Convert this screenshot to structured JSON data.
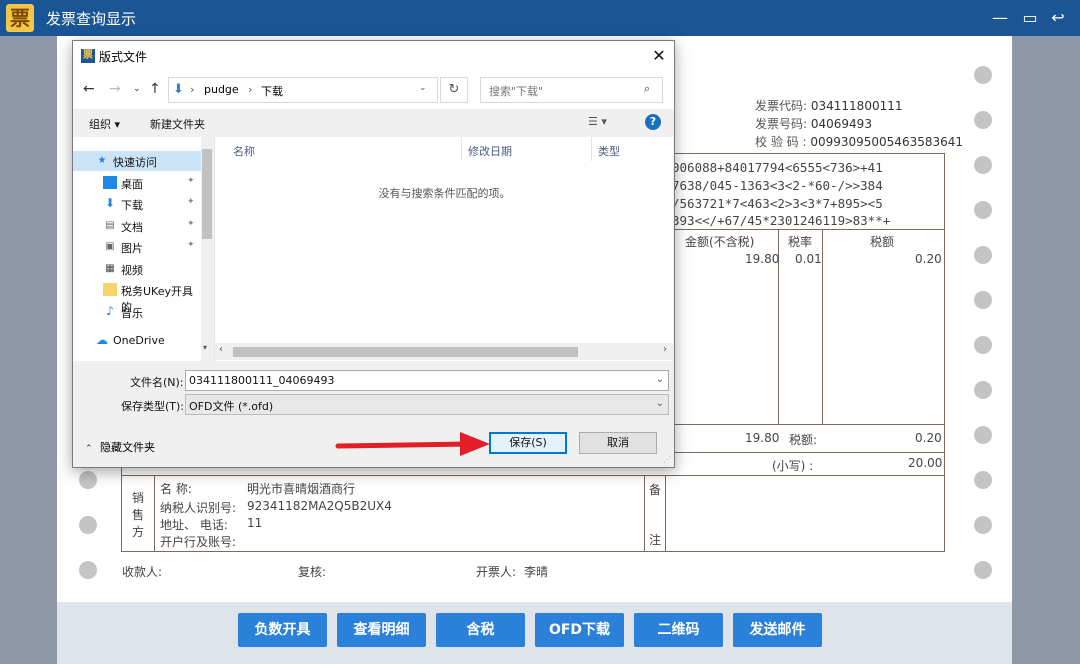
{
  "window": {
    "title": "发票查询显示",
    "logo": "票",
    "min": "—",
    "max": "▭",
    "restore": "↩"
  },
  "invoice": {
    "code_label": "发票代码:",
    "code": "034111800111",
    "number_label": "发票号码:",
    "number": "04069493",
    "check_label": "校 验 码 :",
    "check_code": "00993095005463583641",
    "password_lines": [
      "006088+84017794<6555<736>+41",
      "7638/045-1363<3<2-*60-/>>384",
      "/563721*7<463<2>3<3*7+895><5",
      "393<</+67/45*2301246119>83**+"
    ],
    "amount_header": "金额(不含税)",
    "tax_rate_header": "税率",
    "tax_header": "税额",
    "amount": "19.80",
    "tax_rate": "0.01",
    "tax": "0.20",
    "total_amount": "19.80",
    "total_tax_label": "税额:",
    "total_tax": "0.20",
    "small_label": "(小写) :",
    "total_small": "20.00",
    "seller": {
      "section": [
        "销",
        "售",
        "方"
      ],
      "name_label": "名        称:",
      "name": "明光市喜晴烟酒商行",
      "taxid_label": "纳税人识别号:",
      "taxid": "92341182MA2Q5B2UX4",
      "addr_label": "地址、  电话:",
      "addr": "11",
      "bank_label": "开户行及账号:"
    },
    "remark": [
      "备",
      "注"
    ],
    "payee_label": "收款人:",
    "reviewer_label": "复核:",
    "drawer_label": "开票人:",
    "drawer": "李晴"
  },
  "toolbar": {
    "buttons": [
      "负数开具",
      "查看明细",
      "含税",
      "OFD下载",
      "二维码",
      "发送邮件"
    ]
  },
  "dialog": {
    "title": "版式文件",
    "breadcrumb": [
      "pudge",
      "下载"
    ],
    "search_placeholder": "搜索\"下载\"",
    "organize": "组织 ▾",
    "new_folder": "新建文件夹",
    "nav_items": [
      {
        "label": "快速访问",
        "icon": "star-icon"
      },
      {
        "label": "桌面",
        "icon": "desktop-icon"
      },
      {
        "label": "下载",
        "icon": "download-icon"
      },
      {
        "label": "文档",
        "icon": "document-icon"
      },
      {
        "label": "图片",
        "icon": "picture-icon"
      },
      {
        "label": "视频",
        "icon": "video-icon"
      },
      {
        "label": "税务UKey开具的",
        "icon": "folder-icon"
      },
      {
        "label": "音乐",
        "icon": "music-icon"
      },
      {
        "label": "OneDrive",
        "icon": "cloud-icon"
      }
    ],
    "columns": [
      "名称",
      "修改日期",
      "类型"
    ],
    "empty_message": "没有与搜索条件匹配的项。",
    "filename_label": "文件名(N):",
    "filename": "034111800111_04069493",
    "filetype_label": "保存类型(T):",
    "filetype": "OFD文件 (*.ofd)",
    "hide_folders": "隐藏文件夹",
    "save": "保存(S)",
    "cancel": "取消"
  },
  "colors": {
    "titlebar": "#1b5596",
    "toolbar_button": "#2b80d9",
    "arrow": "#e21f26",
    "table_line": "#7d6b5e"
  }
}
